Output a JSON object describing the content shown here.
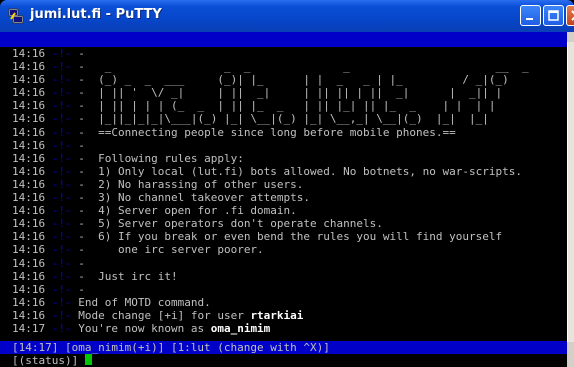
{
  "window": {
    "title": "jumi.lut.fi - PuTTY",
    "icon": "putty-icon"
  },
  "lines": [
    {
      "ts": "14:16",
      "marker": "-!-",
      "text": "-",
      "hl": ""
    },
    {
      "ts": "14:16",
      "marker": "-!-",
      "text": "-   _                 _  _              _                      __  _",
      "hl": ""
    },
    {
      "ts": "14:16",
      "marker": "-!-",
      "text": "-  (_) _  _  ___     (_)| |_      | |  _   _ | |_         / _|(_)",
      "hl": ""
    },
    {
      "ts": "14:16",
      "marker": "-!-",
      "text": "-  | || '  \\/ _|     | ||  _|     | || || | ||  _|      |  _|| |",
      "hl": ""
    },
    {
      "ts": "14:16",
      "marker": "-!-",
      "text": "-  | || | | | (_  _  | || |_  _   | || |_| || |_  _    | |  | |",
      "hl": ""
    },
    {
      "ts": "14:16",
      "marker": "-!-",
      "text": "-  |_||_|_|_|\\___|(_) |_| \\__|(_) |_| \\__,_| \\__|(_)  |_|  |_|",
      "hl": ""
    },
    {
      "ts": "14:16",
      "marker": "-!-",
      "text": "-  ==Connecting people since long before mobile phones.==",
      "hl": ""
    },
    {
      "ts": "14:16",
      "marker": "-!-",
      "text": "-",
      "hl": ""
    },
    {
      "ts": "14:16",
      "marker": "-!-",
      "text": "-  Following rules apply:",
      "hl": ""
    },
    {
      "ts": "14:16",
      "marker": "-!-",
      "text": "-  1) Only local (lut.fi) bots allowed. No botnets, no war-scripts.",
      "hl": ""
    },
    {
      "ts": "14:16",
      "marker": "-!-",
      "text": "-  2) No harassing of other users.",
      "hl": ""
    },
    {
      "ts": "14:16",
      "marker": "-!-",
      "text": "-  3) No channel takeover attempts.",
      "hl": ""
    },
    {
      "ts": "14:16",
      "marker": "-!-",
      "text": "-  4) Server open for .fi domain.",
      "hl": ""
    },
    {
      "ts": "14:16",
      "marker": "-!-",
      "text": "-  5) Server operators don't operate channels.",
      "hl": ""
    },
    {
      "ts": "14:16",
      "marker": "-!-",
      "text": "-  6) If you break or even bend the rules you will find yourself",
      "hl": ""
    },
    {
      "ts": "14:16",
      "marker": "-!-",
      "text": "-     one irc server poorer.",
      "hl": ""
    },
    {
      "ts": "14:16",
      "marker": "-!-",
      "text": "-",
      "hl": ""
    },
    {
      "ts": "14:16",
      "marker": "-!-",
      "text": "-  Just irc it!",
      "hl": ""
    },
    {
      "ts": "14:16",
      "marker": "-!-",
      "text": "-",
      "hl": ""
    },
    {
      "ts": "14:16",
      "marker": "-!-",
      "text": "End of MOTD command.",
      "hl": ""
    },
    {
      "ts": "14:16",
      "marker": "-!-",
      "text": "Mode change [+i] for user ",
      "hl": "rtarkiai"
    },
    {
      "ts": "14:17",
      "marker": "-!-",
      "text": "You're now known as ",
      "hl": "oma_nimim"
    }
  ],
  "statusbar": {
    "text": "[14:17] [oma_nimim(+i)] [1:lut (change with ^X)]"
  },
  "input": {
    "prompt": "[(status)] "
  },
  "colors": {
    "title_bar": "#0646c9",
    "status_bar": "#0000c8",
    "cursor": "#00c800",
    "marker": "#0000e0"
  }
}
